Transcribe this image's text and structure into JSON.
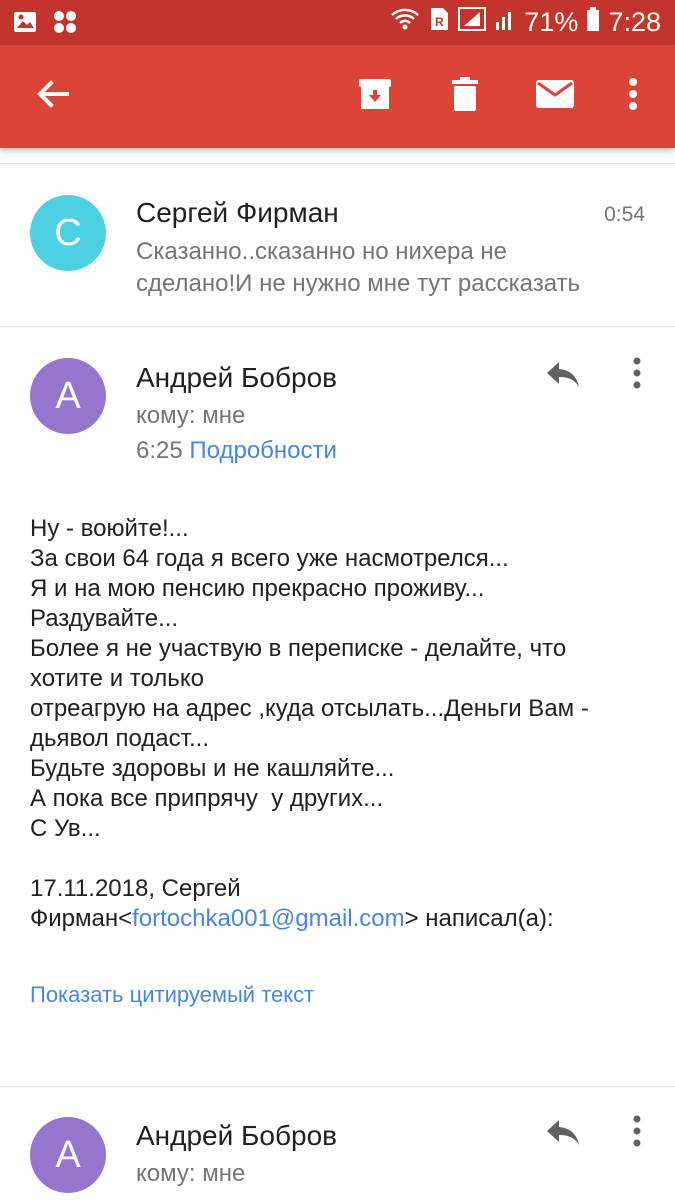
{
  "status_bar": {
    "battery_percent": "71%",
    "clock": "7:28"
  },
  "colors": {
    "status_bar": "#c2352c",
    "app_bar": "#db4437",
    "avatar_teal": "#4dd0e1",
    "avatar_purple": "#9575cd",
    "link": "#4a86d9"
  },
  "toolbar": {
    "icons": [
      "back-arrow-icon",
      "archive-icon",
      "delete-icon",
      "mail-icon",
      "more-vert-icon"
    ]
  },
  "messages": [
    {
      "avatar_letter": "С",
      "sender": "Сергей Фирман",
      "time": "0:54",
      "snippet_lines": [
        "Сказанно..сказанно но нихера не",
        "сделано!И не нужно мне тут рассказать"
      ]
    },
    {
      "avatar_letter": "А",
      "sender": "Андрей Бобров",
      "to": "кому: мне",
      "time": "6:25",
      "details_link": "Подробности",
      "body_lines": [
        "Ну - воюйте!...",
        "За свои 64 года я всего уже насмотрелся...",
        "Я и на мою пенсию прекрасно проживу...",
        "Раздувайте...",
        "Более я не участвую в переписке - делайте, что",
        "хотите и только",
        "отреагрую на адрес ,куда отсылать...Деньги Вам -",
        "дьявол подаст...",
        "Будьте здоровы и не кашляйте...",
        "А пока все припрячу  у других...",
        "С Ув..."
      ],
      "quote_header_line1": "17.11.2018, Сергей",
      "quote_header_prefix": "Фирман<",
      "quote_email": "fortochka001@gmail.com",
      "quote_header_suffix": "> написал(а):",
      "show_quoted": "Показать цитируемый текст"
    },
    {
      "avatar_letter": "А",
      "sender": "Андрей Бобров",
      "to": "кому: мне"
    }
  ]
}
